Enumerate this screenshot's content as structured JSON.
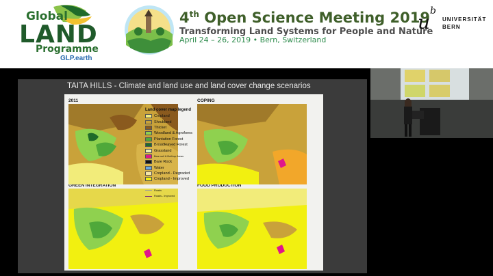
{
  "banner": {
    "glp": {
      "line1": "Global",
      "line2": "LAND",
      "line3": "Programme",
      "url": "GLP.earth"
    },
    "conference": {
      "ordinal_num": "4",
      "ordinal_sup": "th",
      "title_rest": " Open Science Meeting 2019",
      "subtitle": "Transforming Land Systems for People and Nature",
      "date_place": "April 24 – 26, 2019 • Bern, Switzerland"
    },
    "university": {
      "mark_u": "u",
      "mark_b": "b",
      "line1": "UNIVERSITÄT",
      "line2": "BERN"
    }
  },
  "slide": {
    "title": "TAITA HILLS - Climate and land use and land cover change scenarios",
    "maps": [
      {
        "label": "2011"
      },
      {
        "label": "COPING"
      },
      {
        "label": "GREEN INTEGRATION"
      },
      {
        "label": "FOOD PRODUCTION"
      }
    ],
    "legend": {
      "title": "Land cover map legend",
      "items": [
        {
          "label": "Cropland",
          "color": "#f2ec7a"
        },
        {
          "label": "Shrubland",
          "color": "#c9a23a"
        },
        {
          "label": "Thicket",
          "color": "#8a5a1e"
        },
        {
          "label": "Woodland & Agrofores",
          "color": "#8fd14f"
        },
        {
          "label": "Plantation Forest",
          "color": "#4fa83a"
        },
        {
          "label": "Broadleaved Forest",
          "color": "#1f6b2a"
        },
        {
          "label": "Grassland",
          "color": "#e8f0b8"
        },
        {
          "label": "Bare soil & Built-up Areas",
          "color": "#e0158c",
          "tiny": true
        },
        {
          "label": "Bare Rock",
          "color": "#111111"
        },
        {
          "label": "Water",
          "color": "#6aa8e0"
        },
        {
          "label": "Cropland - Degraded",
          "color": "#f5e6a8"
        },
        {
          "label": "Cropland - Improved",
          "color": "#f2f010"
        }
      ],
      "roads": [
        {
          "label": "Roads",
          "color": "#9a9a9a"
        },
        {
          "label": "Roads - Improved",
          "color": "#7a2a7a"
        }
      ]
    }
  }
}
